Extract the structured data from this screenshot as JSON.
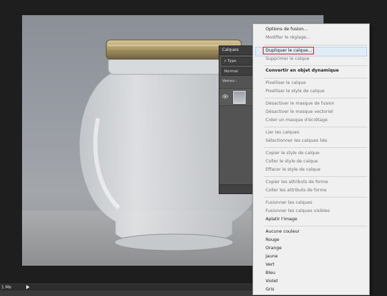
{
  "layers_panel": {
    "title": "Calques",
    "filter_label": "Type",
    "blend_mode": "Normal",
    "lock_label": "Verrou :"
  },
  "context_menu": {
    "items": [
      {
        "label": "Options de fusion...",
        "state": "enabled"
      },
      {
        "label": "Modifier le réglage...",
        "state": "disabled"
      },
      {
        "label": "Dupliquer le calque...",
        "state": "highlighted"
      },
      {
        "label": "Supprimer le calque",
        "state": "disabled"
      },
      {
        "label": "Convertir en objet dynamique",
        "state": "bold"
      },
      {
        "label": "Pixelliser le calque",
        "state": "disabled"
      },
      {
        "label": "Pixelliser le style de calque",
        "state": "disabled"
      },
      {
        "label": "Désactiver le masque de fusion",
        "state": "disabled"
      },
      {
        "label": "Désactiver le masque vectoriel",
        "state": "disabled"
      },
      {
        "label": "Créer un masque d'écrêtage",
        "state": "disabled"
      },
      {
        "label": "Lier les calques",
        "state": "disabled"
      },
      {
        "label": "Sélectionner les calques liés",
        "state": "disabled"
      },
      {
        "label": "Copier le style de calque",
        "state": "disabled"
      },
      {
        "label": "Coller le style de calque",
        "state": "disabled"
      },
      {
        "label": "Effacer le style de calque",
        "state": "disabled"
      },
      {
        "label": "Copier les attributs de forme",
        "state": "disabled"
      },
      {
        "label": "Coller les attributs de forme",
        "state": "disabled"
      },
      {
        "label": "Fusionner les calques",
        "state": "disabled"
      },
      {
        "label": "Fusionner les calques visibles",
        "state": "disabled"
      },
      {
        "label": "Aplatir l'image",
        "state": "enabled"
      },
      {
        "label": "Aucune couleur",
        "state": "enabled"
      },
      {
        "label": "Rouge",
        "state": "enabled"
      },
      {
        "label": "Orange",
        "state": "enabled"
      },
      {
        "label": "Jaune",
        "state": "enabled"
      },
      {
        "label": "Vert",
        "state": "enabled"
      },
      {
        "label": "Bleu",
        "state": "enabled"
      },
      {
        "label": "Violet",
        "state": "enabled"
      },
      {
        "label": "Gris",
        "state": "enabled"
      }
    ]
  },
  "status_bar": {
    "doc_size": "1 Mo"
  },
  "colors": {
    "highlight_outline": "#d01818",
    "menu_background": "#f0f0f0",
    "workspace": "#1e1e1e"
  }
}
